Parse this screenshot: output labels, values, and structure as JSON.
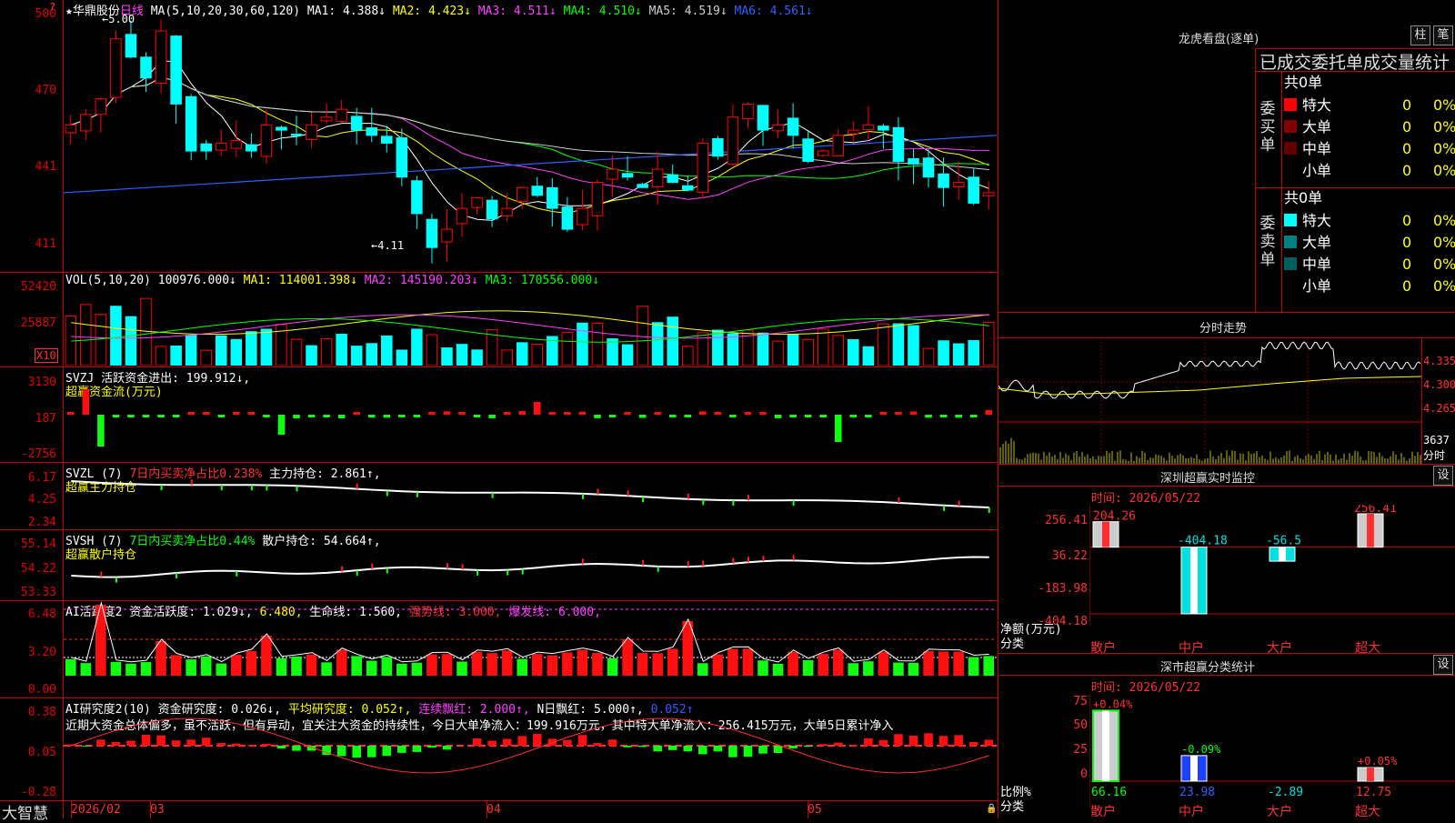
{
  "main": {
    "star": "★",
    "stock_name": "华鼎股份",
    "period": "日线",
    "ma_params": "MA(5,10,20,30,60,120)",
    "ma": [
      {
        "label": "MA1: 4.388↓",
        "color": "#ffffff"
      },
      {
        "label": "MA2: 4.423↓",
        "color": "#ffff00"
      },
      {
        "label": "MA3: 4.511↓",
        "color": "#ff40ff"
      },
      {
        "label": "MA4: 4.510↓",
        "color": "#00ff00"
      },
      {
        "label": "MA5: 4.519↓",
        "color": "#cccccc"
      },
      {
        "label": "MA6: 4.561↓",
        "color": "#3060ff"
      }
    ],
    "y_labels": [
      "500",
      "470",
      "441",
      "411"
    ],
    "high_marker": "←5.00",
    "low_marker": "←4.11",
    "corner_mark": "?"
  },
  "vol": {
    "header": "VOL(5,10,20)",
    "value": "100976.000↓",
    "ma": [
      {
        "label": "MA1: 114001.398↓",
        "color": "#ffff00"
      },
      {
        "label": "MA2: 145190.203↓",
        "color": "#ff40ff"
      },
      {
        "label": "MA3: 170556.000↓",
        "color": "#00ff00"
      }
    ],
    "y_labels": [
      "52420",
      "25887"
    ],
    "unit": "X10"
  },
  "svzj": {
    "name": "SVZJ",
    "line1": "活跃资金进出: 199.912↓,",
    "line2": "超赢资金流(万元)",
    "y_labels": [
      "3130",
      "187",
      "-2756"
    ]
  },
  "svzl": {
    "name": "SVZL (7)",
    "part1": "7日内买卖净占比0.238%",
    "part2": "主力持仓: 2.861↑,",
    "line2": "超赢主力持仓",
    "y_labels": [
      "6.17",
      "4.25",
      "2.34"
    ]
  },
  "svsh": {
    "name": "SVSH (7)",
    "part1": "7日内买卖净占比0.44%",
    "part2": "散户持仓: 54.664↑,",
    "line2": "超赢散户持仓",
    "y_labels": [
      "55.14",
      "54.22",
      "53.33"
    ]
  },
  "ai2": {
    "name": "AI活跃度2",
    "items": [
      {
        "label": "资金活跃度: 1.029↓,",
        "color": "#ffffff"
      },
      {
        "label": "6.480,",
        "color": "#ffff00"
      },
      {
        "label": "生命线: 1.560,",
        "color": "#ffffff"
      },
      {
        "label": "强势线: 3.000,",
        "color": "#ff3030"
      },
      {
        "label": "爆发线: 6.000,",
        "color": "#ff40ff"
      }
    ],
    "y_labels": [
      "6.48",
      "3.20",
      "0.00"
    ]
  },
  "ai_research": {
    "name": "AI研究度2(10)",
    "items": [
      {
        "label": "资金研究度: 0.026↓,",
        "color": "#ffffff"
      },
      {
        "label": "平均研究度: 0.052↑,",
        "color": "#ffff00"
      },
      {
        "label": "连续飘红: 2.000↑,",
        "color": "#ff40ff"
      },
      {
        "label": "N日飘红: 5.000↑,",
        "color": "#ffffff"
      },
      {
        "label": "0.052↑",
        "color": "#3060ff"
      }
    ],
    "comment": "近期大资金总体偏多，虽不活跃，但有异动，宜关注大资金的持续性，今日大单净流入：199.916万元，其中特大单净流入：256.415万元，大单5日累计净入",
    "y_labels": [
      "0.38",
      "0.05",
      "-0.28"
    ]
  },
  "footer": {
    "brand": "大智慧",
    "dates": [
      "2026/02",
      "03",
      "04",
      "05"
    ]
  },
  "longhu": {
    "title": "龙虎看盘(逐单)",
    "btn1": "柱",
    "btn2": "笔",
    "subtitle": "已成交委托单成交量统计",
    "buy_label": "委买单",
    "sell_label": "委卖单",
    "buy_total": "共0单",
    "sell_total": "共0单",
    "buy_rows": [
      {
        "name": "特大",
        "color": "#ff0000",
        "n": "0",
        "pct": "0%"
      },
      {
        "name": "大单",
        "color": "#800000",
        "n": "0",
        "pct": "0%"
      },
      {
        "name": "中单",
        "color": "#600000",
        "n": "0",
        "pct": "0%"
      },
      {
        "name": "小单",
        "color": "#000000",
        "n": "0",
        "pct": "0%"
      }
    ],
    "sell_rows": [
      {
        "name": "特大",
        "color": "#00ffff",
        "n": "0",
        "pct": "0%"
      },
      {
        "name": "大单",
        "color": "#008080",
        "n": "0",
        "pct": "0%"
      },
      {
        "name": "中单",
        "color": "#006060",
        "n": "0",
        "pct": "0%"
      },
      {
        "name": "小单",
        "color": "#000000",
        "n": "0",
        "pct": "0%"
      }
    ]
  },
  "minute": {
    "title": "分时走势",
    "y_labels": [
      "4.335",
      "4.300",
      "4.265"
    ],
    "vol_label": "3637",
    "vol_unit": "分时"
  },
  "sz_monitor": {
    "title": "深圳超赢实时监控",
    "set": "设",
    "time": "时间: 2026/05/22",
    "y_labels": [
      "256.41",
      "36.22",
      "-183.98",
      "-404.18"
    ],
    "axis_title": "净额(万元)",
    "axis_sub": "分类",
    "categories": [
      "散户",
      "中户",
      "大户",
      "超大"
    ],
    "values": [
      "204.26",
      "-404.18",
      "-56.5",
      "256.41"
    ],
    "chart_data": {
      "type": "bar",
      "categories": [
        "散户",
        "中户",
        "大户",
        "超大"
      ],
      "values": [
        204.26,
        -404.18,
        -56.5,
        256.41
      ],
      "ylabel": "净额(万元)",
      "ylim": [
        -404.18,
        256.41
      ]
    }
  },
  "sz_class": {
    "title": "深市超赢分类统计",
    "set": "设",
    "time": "时间: 2026/05/22",
    "y_labels": [
      "75",
      "50",
      "25",
      "0"
    ],
    "axis_title": "比例%",
    "axis_sub": "分类",
    "categories": [
      "散户",
      "中户",
      "大户",
      "超大"
    ],
    "top_labels": [
      "+0.04%",
      "-0.09%",
      "",
      "+0.05%"
    ],
    "values": [
      "66.16",
      "23.98",
      "-2.89",
      "12.75"
    ],
    "chart_data": {
      "type": "bar",
      "categories": [
        "散户",
        "中户",
        "大户",
        "超大"
      ],
      "values": [
        66.16,
        23.98,
        -2.89,
        12.75
      ],
      "ylabel": "比例%",
      "ylim": [
        0,
        75
      ]
    }
  },
  "colors": {
    "up": "#ff0000",
    "down": "#00ffff",
    "grid": "#c00000",
    "vol_down": "#00ffff"
  }
}
